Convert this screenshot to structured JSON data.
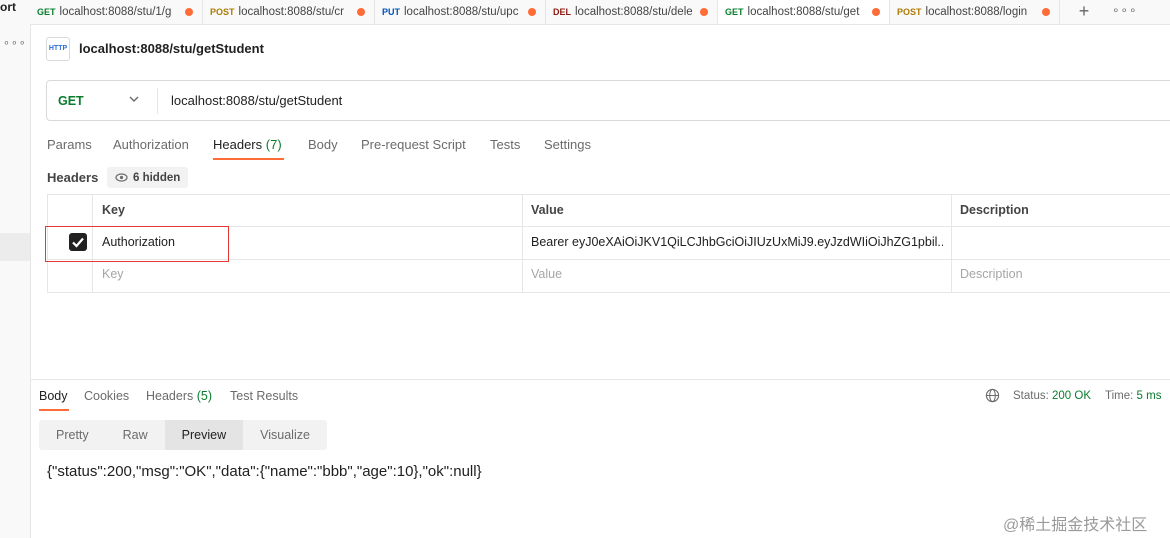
{
  "sidebar": {
    "partial_label": "ort",
    "more_icon": "more-dots-icon"
  },
  "tabs": [
    {
      "method": "GET",
      "method_color": "#0a7d2c",
      "url": "localhost:8088/stu/1/g"
    },
    {
      "method": "POST",
      "method_color": "#ad7a03",
      "url": "localhost:8088/stu/cr"
    },
    {
      "method": "PUT",
      "method_color": "#0053b8",
      "url": "localhost:8088/stu/upc"
    },
    {
      "method": "DEL",
      "method_color": "#8e1a10",
      "url": "localhost:8088/stu/dele"
    },
    {
      "method": "GET",
      "method_color": "#0a7d2c",
      "url": "localhost:8088/stu/get",
      "active": true
    },
    {
      "method": "POST",
      "method_color": "#ad7a03",
      "url": "localhost:8088/login"
    }
  ],
  "tab_unsaved_dot_color": "#ff6c37",
  "request": {
    "icon_text": "HTTP",
    "title": "localhost:8088/stu/getStudent",
    "method": "GET",
    "url": "localhost:8088/stu/getStudent"
  },
  "request_tabs": {
    "params": "Params",
    "authorization": "Authorization",
    "headers": "Headers",
    "headers_count": "(7)",
    "body": "Body",
    "pre_request": "Pre-request Script",
    "tests": "Tests",
    "settings": "Settings"
  },
  "headers_section": {
    "label": "Headers",
    "hidden": "6 hidden"
  },
  "headers_table": {
    "columns": {
      "key": "Key",
      "value": "Value",
      "description": "Description"
    },
    "rows": [
      {
        "checked": true,
        "key": "Authorization",
        "value": "Bearer eyJ0eXAiOiJKV1QiLCJhbGciOiJIUzUxMiJ9.eyJzdWIiOiJhZG1pbil...",
        "description": ""
      }
    ],
    "placeholder": {
      "key": "Key",
      "value": "Value",
      "description": "Description"
    }
  },
  "response": {
    "tabs": {
      "body": "Body",
      "cookies": "Cookies",
      "headers": "Headers",
      "headers_count": "(5)",
      "test_results": "Test Results"
    },
    "status_label": "Status:",
    "status_value": "200 OK",
    "time_label": "Time:",
    "time_value": "5 ms",
    "views": [
      "Pretty",
      "Raw",
      "Preview",
      "Visualize"
    ],
    "active_view": "Preview",
    "body_text": "{\"status\":200,\"msg\":\"OK\",\"data\":{\"name\":\"bbb\",\"age\":10},\"ok\":null}"
  },
  "watermark": "@稀土掘金技术社区",
  "colors": {
    "accent": "#ff6c37",
    "success": "#0a7d2c",
    "highlight_box": "#e53935"
  }
}
